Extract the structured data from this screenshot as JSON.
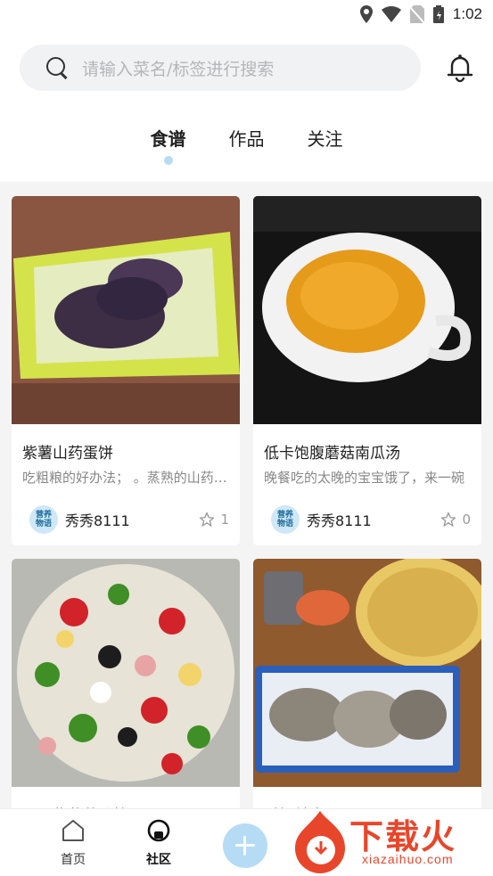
{
  "status_bar": {
    "time": "1:02"
  },
  "search": {
    "placeholder": "请输入菜名/标签进行搜索"
  },
  "tabs": [
    {
      "label": "食谱",
      "active": true
    },
    {
      "label": "作品",
      "active": false
    },
    {
      "label": "关注",
      "active": false
    }
  ],
  "cards": [
    {
      "title": "紫薯山药蛋饼",
      "desc": "吃粗粮的好办法；  。蒸熟的山药和紫薯",
      "author": "秀秀8111",
      "likes": "1"
    },
    {
      "title": "低卡饱腹蘑菇南瓜汤",
      "desc": "晚餐吃的太晚的宝宝饿了，来一碗",
      "author": "秀秀8111",
      "likes": "0"
    },
    {
      "title": "火腿紫菜花沙拉",
      "desc": "",
      "author": "",
      "likes": ""
    },
    {
      "title": "手抓羊肉",
      "desc": "",
      "author": "",
      "likes": ""
    }
  ],
  "avatar_text": [
    "营养",
    "物语"
  ],
  "bottom_nav": {
    "home": "首页",
    "community": "社区"
  },
  "watermark": {
    "brand": "下载火",
    "url": "xiazaihuo.com"
  },
  "colors": {
    "accent": "#b5dbf5",
    "watermark": "#e8462b"
  }
}
